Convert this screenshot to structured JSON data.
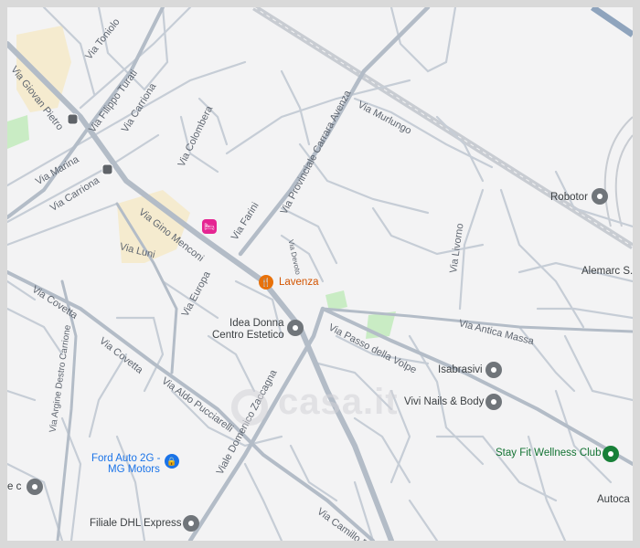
{
  "map": {
    "streets": [
      "Via Giovan Pietro",
      "Via Toniolo",
      "Via Filippo Turati",
      "Via Carriona",
      "Via Marina",
      "Via Carriona",
      "Via Colombera",
      "Via Gino Menconi",
      "Via Luni",
      "Via Farini",
      "Via Provinciale Carrara Avenza",
      "Via Murlungo",
      "Via Europa",
      "Via Covetta",
      "Via Covetta",
      "Via Aldo Pucciarelli",
      "Via Argine Destro Carrione",
      "Viale Domenico Zaccagna",
      "Via Camillo Bo",
      "Via Passo della Volpe",
      "Via Antica Massa",
      "Via Livorno",
      "Via Devoto"
    ],
    "places": {
      "robotor": "Robotor",
      "alemarc": "Alemarc S.r.",
      "lavenza": "Lavenza",
      "idea_donna_1": "Idea Donna",
      "idea_donna_2": "Centro Estetico",
      "isabrasivi": "Isabrasivi",
      "vivi_nails": "Vivi Nails & Body",
      "stay_fit": "Stay Fit Wellness Club",
      "autoca": "Autoca",
      "ford_1": "Ford Auto 2G -",
      "ford_2": "MG Motors",
      "dhl": "Filiale DHL Express",
      "ec": "e c"
    },
    "watermark": "casa.it",
    "colors": {
      "background": "#f3f3f4",
      "road": "#c6cdd6",
      "major_road": "#b3bcc7",
      "park": "#c9ecc4",
      "urban": "#f5ebcf",
      "railway": "#c8ccd2",
      "highway": "#8fa4bd"
    }
  }
}
